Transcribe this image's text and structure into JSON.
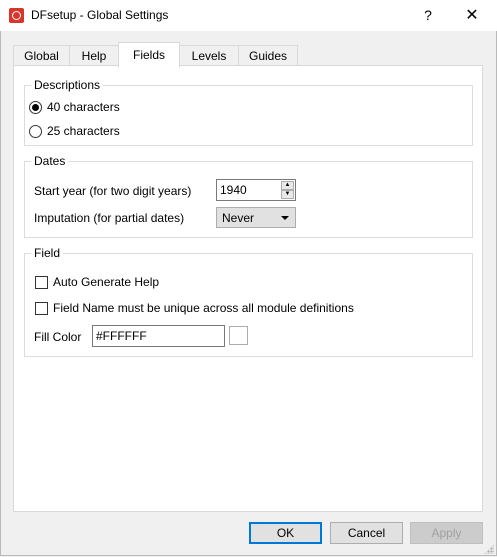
{
  "window": {
    "title": "DFsetup - Global Settings",
    "help_glyph": "?",
    "close_glyph": "✕"
  },
  "tabs": [
    {
      "label": "Global",
      "active": false
    },
    {
      "label": "Help",
      "active": false
    },
    {
      "label": "Fields",
      "active": true
    },
    {
      "label": "Levels",
      "active": false
    },
    {
      "label": "Guides",
      "active": false
    }
  ],
  "descriptions": {
    "title": "Descriptions",
    "option_40": "40 characters",
    "option_25": "25 characters",
    "selected": "40 characters"
  },
  "dates": {
    "title": "Dates",
    "start_year_label": "Start year (for two digit years)",
    "start_year_value": "1940",
    "imputation_label": "Imputation (for partial dates)",
    "imputation_value": "Never"
  },
  "field": {
    "title": "Field",
    "auto_help_label": "Auto Generate Help",
    "auto_help_checked": false,
    "unique_name_label": "Field Name must be unique across all module definitions",
    "unique_name_checked": false,
    "fill_color_label": "Fill Color",
    "fill_color_value": "#FFFFFF",
    "swatch_color": "#FFFFFF"
  },
  "buttons": {
    "ok": "OK",
    "cancel": "Cancel",
    "apply": "Apply"
  },
  "colors": {
    "accent": "#0078d7",
    "app_icon": "#d9352b"
  }
}
